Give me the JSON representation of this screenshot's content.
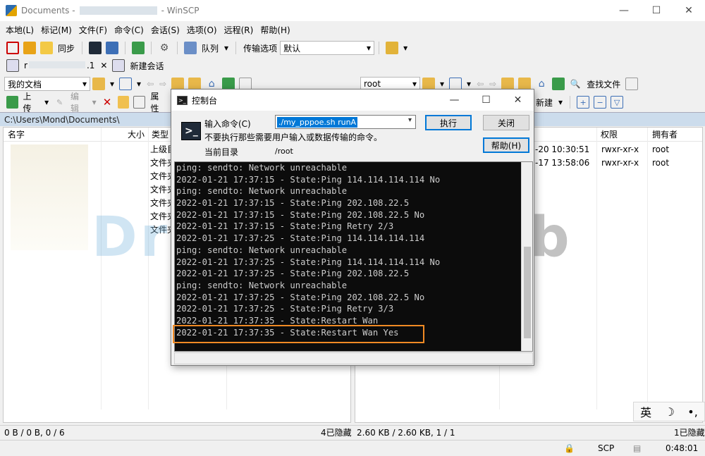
{
  "window": {
    "title_prefix": "Documents -",
    "title_suffix": "- WinSCP",
    "minimize": "—",
    "maximize": "☐",
    "close": "✕"
  },
  "menu": [
    "本地(L)",
    "标记(M)",
    "文件(F)",
    "命令(C)",
    "会话(S)",
    "选项(O)",
    "远程(R)",
    "帮助(H)"
  ],
  "toolbar": {
    "sync_label": "同步",
    "queue_label": "队列",
    "transfer_options_label": "传输选项",
    "transfer_options_value": "默认"
  },
  "session_tabs": {
    "session_name_prefix": "r",
    "session_name_suffix": ".1",
    "new_session_label": "新建会话"
  },
  "left_panel": {
    "location": "我的文档",
    "path": "C:\\Users\\Mond\\Documents\\",
    "upload_label": "上传",
    "edit_label": "编辑",
    "properties_label": "属性",
    "columns": {
      "name": "名字",
      "size": "大小",
      "type": "类型"
    },
    "types": [
      "上级目",
      "文件夹",
      "文件夹",
      "文件夹",
      "文件夹",
      "文件夹",
      "文件夹"
    ]
  },
  "right_panel": {
    "location": "root",
    "find_files_label": "查找文件",
    "new_label": "新建",
    "columns": {
      "rights": "权限",
      "owner": "拥有者"
    },
    "rows": [
      {
        "changed": "-20  10:30:51",
        "rights": "rwxr-xr-x",
        "owner": "root"
      },
      {
        "changed": "-17  13:58:06",
        "rights": "rwxr-xr-x",
        "owner": "root"
      }
    ]
  },
  "watermark": {
    "left": "Dre",
    "mid": "B",
    "right": "Lab"
  },
  "console": {
    "title": "控制台",
    "command_label": "输入命令(C)",
    "command_value": "./my_pppoe.sh runA",
    "hint": "不要执行那些需要用户输入或数据传输的命令。",
    "cwd_label": "当前目录",
    "cwd_value": "/root",
    "execute_button": "执行",
    "close_button": "关闭",
    "help_button": "帮助(H)",
    "output": [
      "ping: sendto: Network unreachable",
      "2022-01-21 17:37:15 - State:Ping 114.114.114.114 No",
      "ping: sendto: Network unreachable",
      "2022-01-21 17:37:15 - State:Ping 202.108.22.5",
      "2022-01-21 17:37:15 - State:Ping 202.108.22.5 No",
      "2022-01-21 17:37:15 - State:Ping Retry 2/3",
      "2022-01-21 17:37:25 - State:Ping 114.114.114.114",
      "ping: sendto: Network unreachable",
      "2022-01-21 17:37:25 - State:Ping 114.114.114.114 No",
      "2022-01-21 17:37:25 - State:Ping 202.108.22.5",
      "ping: sendto: Network unreachable",
      "2022-01-21 17:37:25 - State:Ping 202.108.22.5 No",
      "2022-01-21 17:37:25 - State:Ping Retry 3/3",
      "2022-01-21 17:37:35 - State:Restart Wan",
      "2022-01-21 17:37:35 - State:Restart Wan Yes"
    ]
  },
  "status": {
    "left_summary": "0 B / 0 B,  0 / 6",
    "hidden_right": "4已隐藏",
    "right_summary": "2.60 KB / 2.60 KB,  1 / 1",
    "hidden_far": "1已隐藏",
    "protocol": "SCP",
    "elapsed": "0:48:01"
  },
  "ime": {
    "lang": "英",
    "moon": "☽",
    "punct": "•,"
  }
}
